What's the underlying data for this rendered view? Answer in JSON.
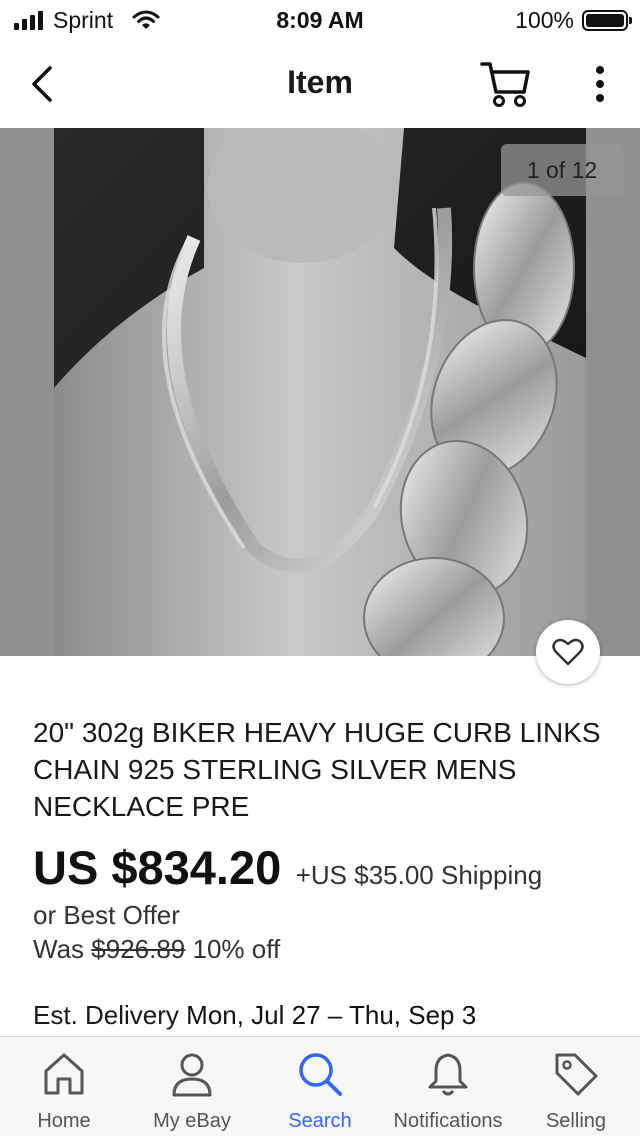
{
  "status_bar": {
    "carrier": "Sprint",
    "time": "8:09 AM",
    "battery": "100%"
  },
  "nav": {
    "title": "Item",
    "icons": [
      "chevron-left-icon",
      "cart-icon",
      "more-vertical-icon"
    ]
  },
  "gallery": {
    "counter": "1 of 12"
  },
  "item": {
    "title": "20\" 302g BIKER HEAVY HUGE CURB LINKS CHAIN 925 STERLING SILVER MENS NECKLACE PRE",
    "price": "US $834.20",
    "shipping": "+US $35.00 Shipping",
    "best_offer": "or Best Offer",
    "was_label": "Was",
    "was_price": "$926.89",
    "discount": "10% off",
    "delivery_label": "Est. Delivery",
    "delivery_dates": "Mon, Jul 27 – Thu, Sep 3"
  },
  "tab_bar": {
    "tabs": [
      {
        "label": "Home",
        "icon": "home-icon"
      },
      {
        "label": "My eBay",
        "icon": "user-icon"
      },
      {
        "label": "Search",
        "icon": "search-icon",
        "active": true
      },
      {
        "label": "Notifications",
        "icon": "bell-icon"
      },
      {
        "label": "Selling",
        "icon": "tag-icon"
      }
    ],
    "active_color": "#3665f3"
  }
}
